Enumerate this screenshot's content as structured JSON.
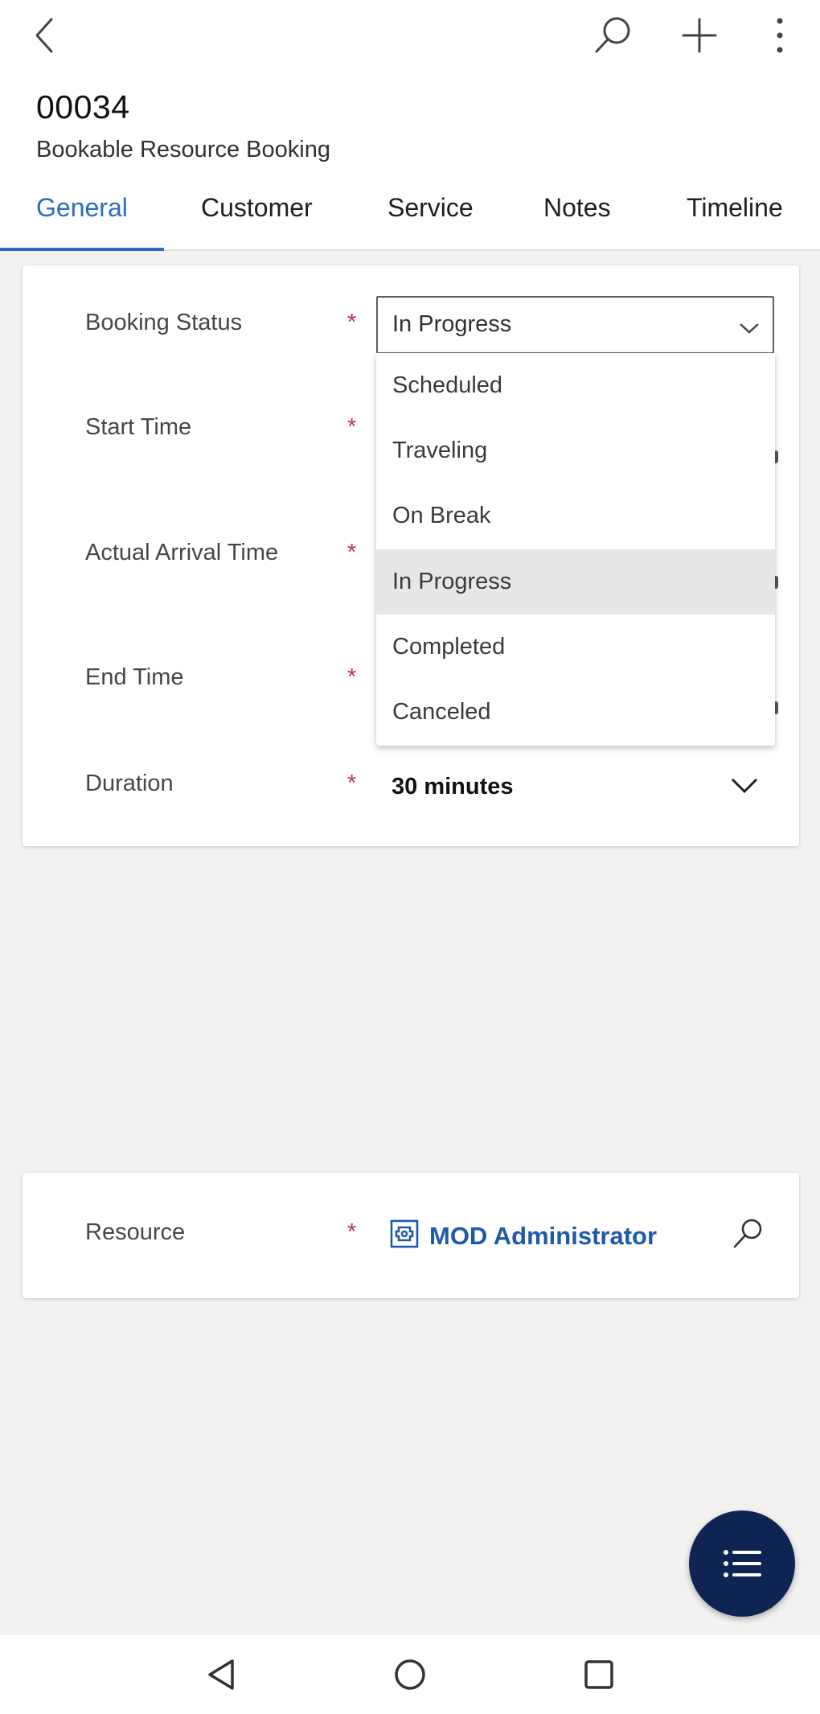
{
  "header": {
    "record_id": "00034",
    "entity_name": "Bookable Resource Booking"
  },
  "tabs": [
    {
      "label": "General",
      "active": true
    },
    {
      "label": "Customer",
      "active": false
    },
    {
      "label": "Service",
      "active": false
    },
    {
      "label": "Notes",
      "active": false
    },
    {
      "label": "Timeline",
      "active": false
    }
  ],
  "form": {
    "required_marker": "*",
    "booking_status": {
      "label": "Booking Status",
      "value": "In Progress",
      "options": [
        "Scheduled",
        "Traveling",
        "On Break",
        "In Progress",
        "Completed",
        "Canceled"
      ],
      "selected_index": 3
    },
    "start_time": {
      "label": "Start Time"
    },
    "actual_arrival_time": {
      "label": "Actual Arrival Time"
    },
    "end_time": {
      "label": "End Time"
    },
    "duration": {
      "label": "Duration",
      "value": "30 minutes"
    }
  },
  "resource": {
    "label": "Resource",
    "value": "MOD Administrator"
  },
  "icons": {
    "back": "chevron-left-icon",
    "search": "search-icon",
    "add": "plus-icon",
    "more": "more-vertical-icon",
    "fab": "list-icon"
  },
  "colors": {
    "accent": "#2b6cc4",
    "required": "#c4314b",
    "link": "#1e5aa8",
    "fab": "#0e2452"
  }
}
